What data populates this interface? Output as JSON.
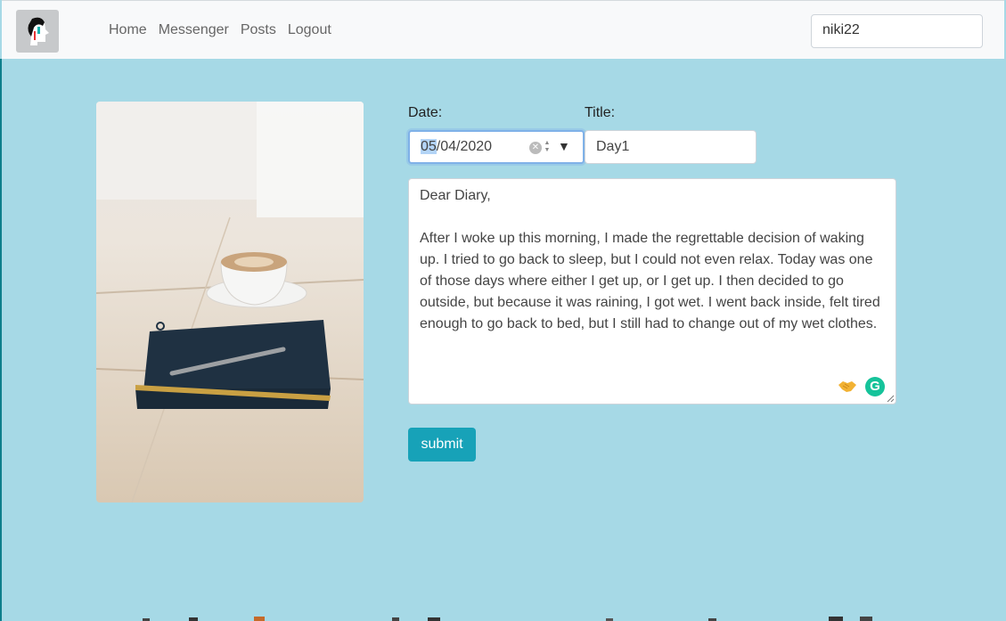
{
  "nav": {
    "links": [
      "Home",
      "Messenger",
      "Posts",
      "Logout"
    ],
    "username": "niki22"
  },
  "form": {
    "date_label": "Date:",
    "date_month": "05",
    "date_rest": "/04/2020",
    "title_label": "Title:",
    "title_value": "Day1",
    "body": "Dear Diary,\n\nAfter I woke up this morning, I made the regrettable decision of waking up. I tried to go back to sleep, but I could not even relax. Today was one of those days where either I get up, or I get up. I then decided to go outside, but because it was raining, I got wet. I went back inside, felt tired enough to go back to bed, but I still had to change out of my wet clothes.",
    "submit_label": "submit"
  },
  "colors": {
    "background": "#a6d9e6",
    "navbar": "#f8f9fa",
    "submit": "#17a2b8",
    "grammarly": "#15c39a"
  }
}
